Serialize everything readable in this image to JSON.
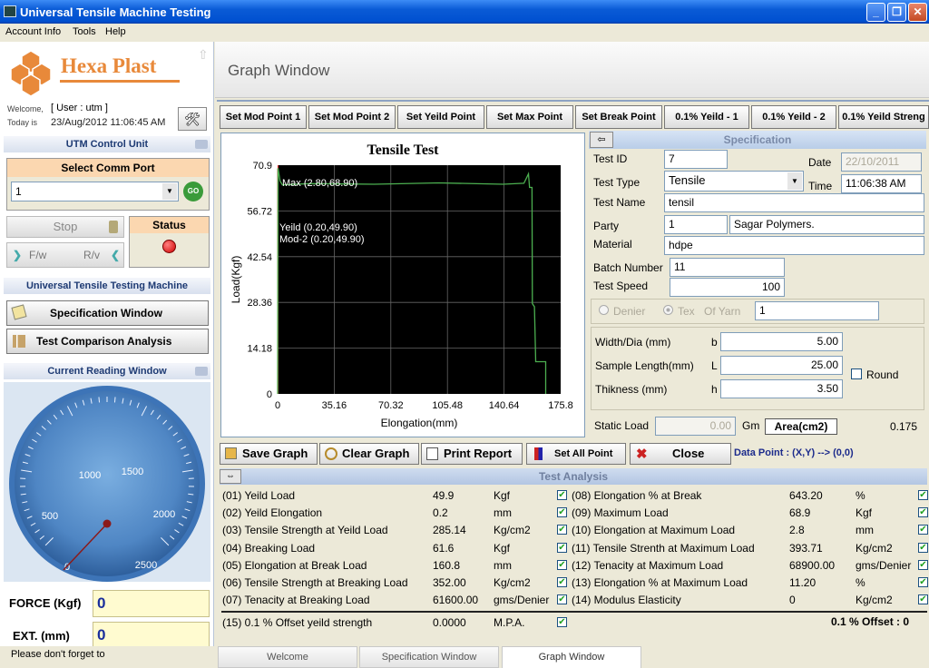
{
  "window": {
    "title": "Universal Tensile Machine Testing"
  },
  "menu": [
    "Account Info",
    "Tools",
    "Help"
  ],
  "brand": {
    "name": "Hexa Plast"
  },
  "user": {
    "welcome_label": "Welcome,",
    "user": "[ User : utm ]",
    "today_label": "Today is",
    "today": "23/Aug/2012  11:06:45 AM"
  },
  "control": {
    "title": "UTM Control Unit",
    "comm_port_label": "Select Comm Port",
    "comm_port_value": "1",
    "go_label": "GO",
    "stop_label": "Stop",
    "status_label": "Status",
    "fw_label": "F/w",
    "rv_label": "R/v"
  },
  "machine": {
    "title": "Universal Tensile Testing Machine",
    "spec_btn": "Specification Window",
    "compare_btn": "Test Comparison Analysis"
  },
  "reading": {
    "title": "Current Reading Window",
    "gauge_ticks": [
      "0",
      "500",
      "1000",
      "1500",
      "2000",
      "2500"
    ],
    "force_label": "FORCE (Kgf)",
    "force_value": "0",
    "ext_label": "EXT.  (mm)",
    "ext_value": "0"
  },
  "status_bar": "Please don't forget to",
  "graph_window": {
    "title": "Graph Window"
  },
  "toolbar": [
    "Set Mod Point 1",
    "Set Mod Point 2",
    "Set Yeild Point",
    "Set Max Point",
    "Set Break Point",
    "0.1% Yeild - 1",
    "0.1% Yeild - 2",
    "0.1% Yeild Streng"
  ],
  "chart_data": {
    "type": "line",
    "title": "Tensile Test",
    "xlabel": "Elongation(mm)",
    "ylabel": "Load(Kgf)",
    "xlim": [
      0,
      175.8
    ],
    "ylim": [
      0,
      70.9
    ],
    "xticks": [
      "0",
      "35.16",
      "70.32",
      "105.48",
      "140.64",
      "175.8"
    ],
    "yticks": [
      "0",
      "14.18",
      "28.36",
      "42.54",
      "56.72",
      "70.9"
    ],
    "grid": true,
    "series": [
      {
        "color": "#4caf50",
        "points": [
          [
            0,
            0
          ],
          [
            0.2,
            70.0
          ],
          [
            1.5,
            66.0
          ],
          [
            3,
            64.8
          ],
          [
            20,
            65.2
          ],
          [
            60,
            65.0
          ],
          [
            100,
            65.4
          ],
          [
            140,
            65.0
          ],
          [
            153,
            65.3
          ],
          [
            155.8,
            68.2
          ],
          [
            156.5,
            64.0
          ],
          [
            158,
            64.0
          ],
          [
            158.2,
            28.0
          ],
          [
            159.5,
            27.0
          ],
          [
            160.3,
            10.0
          ],
          [
            161,
            10.0
          ],
          [
            166.5,
            10.0
          ],
          [
            166.5,
            0
          ]
        ]
      }
    ],
    "markers": {
      "color": "#ff4040",
      "x": [
        0.2,
        2.8
      ],
      "y": [
        49.9,
        68.9
      ]
    },
    "annotations": [
      "Max (2.80,68.90)",
      "Yeild (0.20,49.90)",
      "Mod-2 (0.20,49.90)"
    ]
  },
  "spec": {
    "header": "Specification",
    "test_id_label": "Test ID",
    "test_id": "7",
    "date_label": "Date",
    "date": "22/10/2011",
    "test_type_label": "Test Type",
    "test_type": "Tensile",
    "time_label": "Time",
    "time": "11:06:38 AM",
    "test_name_label": "Test Name",
    "test_name": "tensil",
    "party_label": "Party",
    "party_code": "1",
    "party_name": "Sagar Polymers.",
    "material_label": "Material",
    "material": "hdpe",
    "batch_label": "Batch Number",
    "batch": "11",
    "speed_label": "Test Speed",
    "speed": "100",
    "denier_label": "Denier",
    "tex_label": "Tex",
    "yarn_label": "Of Yarn",
    "yarn_value": "1",
    "width_label": "Width/Dia (mm)",
    "width_sym": "b",
    "width": "5.00",
    "length_label": "Sample Length(mm)",
    "length_sym": "L",
    "length": "25.00",
    "round_label": "Round",
    "thick_label": "Thikness (mm)",
    "thick_sym": "h",
    "thick": "3.50",
    "static_label": "Static Load",
    "static_value": "0.00",
    "gm_label": "Gm",
    "area_label": "Area(cm2)",
    "area_value": "0.175"
  },
  "actions": {
    "save": "Save Graph",
    "clear": "Clear Graph",
    "print": "Print Report",
    "setall": "Set All Point",
    "close": "Close",
    "datapoint": "Data Point : (X,Y) --> (0,0)"
  },
  "analysis": {
    "title": "Test Analysis",
    "left": [
      {
        "label": "(01) Yeild Load",
        "value": "49.9",
        "unit": "Kgf"
      },
      {
        "label": "(02) Yeild Elongation",
        "value": "0.2",
        "unit": "mm"
      },
      {
        "label": "(03) Tensile Strength at Yeild Load",
        "value": "285.14",
        "unit": "Kg/cm2"
      },
      {
        "label": "(04) Breaking Load",
        "value": "61.6",
        "unit": "Kgf"
      },
      {
        "label": "(05) Elongation at Break Load",
        "value": "160.8",
        "unit": "mm"
      },
      {
        "label": "(06) Tensile Strength at Breaking Load",
        "value": "352.00",
        "unit": "Kg/cm2"
      },
      {
        "label": "(07) Tenacity at Breaking Load",
        "value": "61600.00",
        "unit": "gms/Denier"
      }
    ],
    "right": [
      {
        "label": "(08) Elongation % at Break",
        "value": "643.20",
        "unit": "%"
      },
      {
        "label": "(09) Maximum Load",
        "value": "68.9",
        "unit": "Kgf"
      },
      {
        "label": "(10) Elongation at Maximum Load",
        "value": "2.8",
        "unit": "mm"
      },
      {
        "label": "(11) Tensile Strenth at Maximum Load",
        "value": "393.71",
        "unit": "Kg/cm2"
      },
      {
        "label": "(12) Tenacity at Maximum Load",
        "value": "68900.00",
        "unit": "gms/Denier"
      },
      {
        "label": "(13) Elongation % at Maximum Load",
        "value": "11.20",
        "unit": "%"
      },
      {
        "label": "(14) Modulus Elasticity",
        "value": "0",
        "unit": "Kg/cm2"
      }
    ],
    "offset": {
      "label": "(15) 0.1 % Offset yeild strength",
      "value": "0.0000",
      "unit": "M.P.A.",
      "summary": "0.1 % Offset : 0"
    }
  },
  "tabs": [
    "Welcome",
    "Specification Window",
    "Graph Window"
  ]
}
